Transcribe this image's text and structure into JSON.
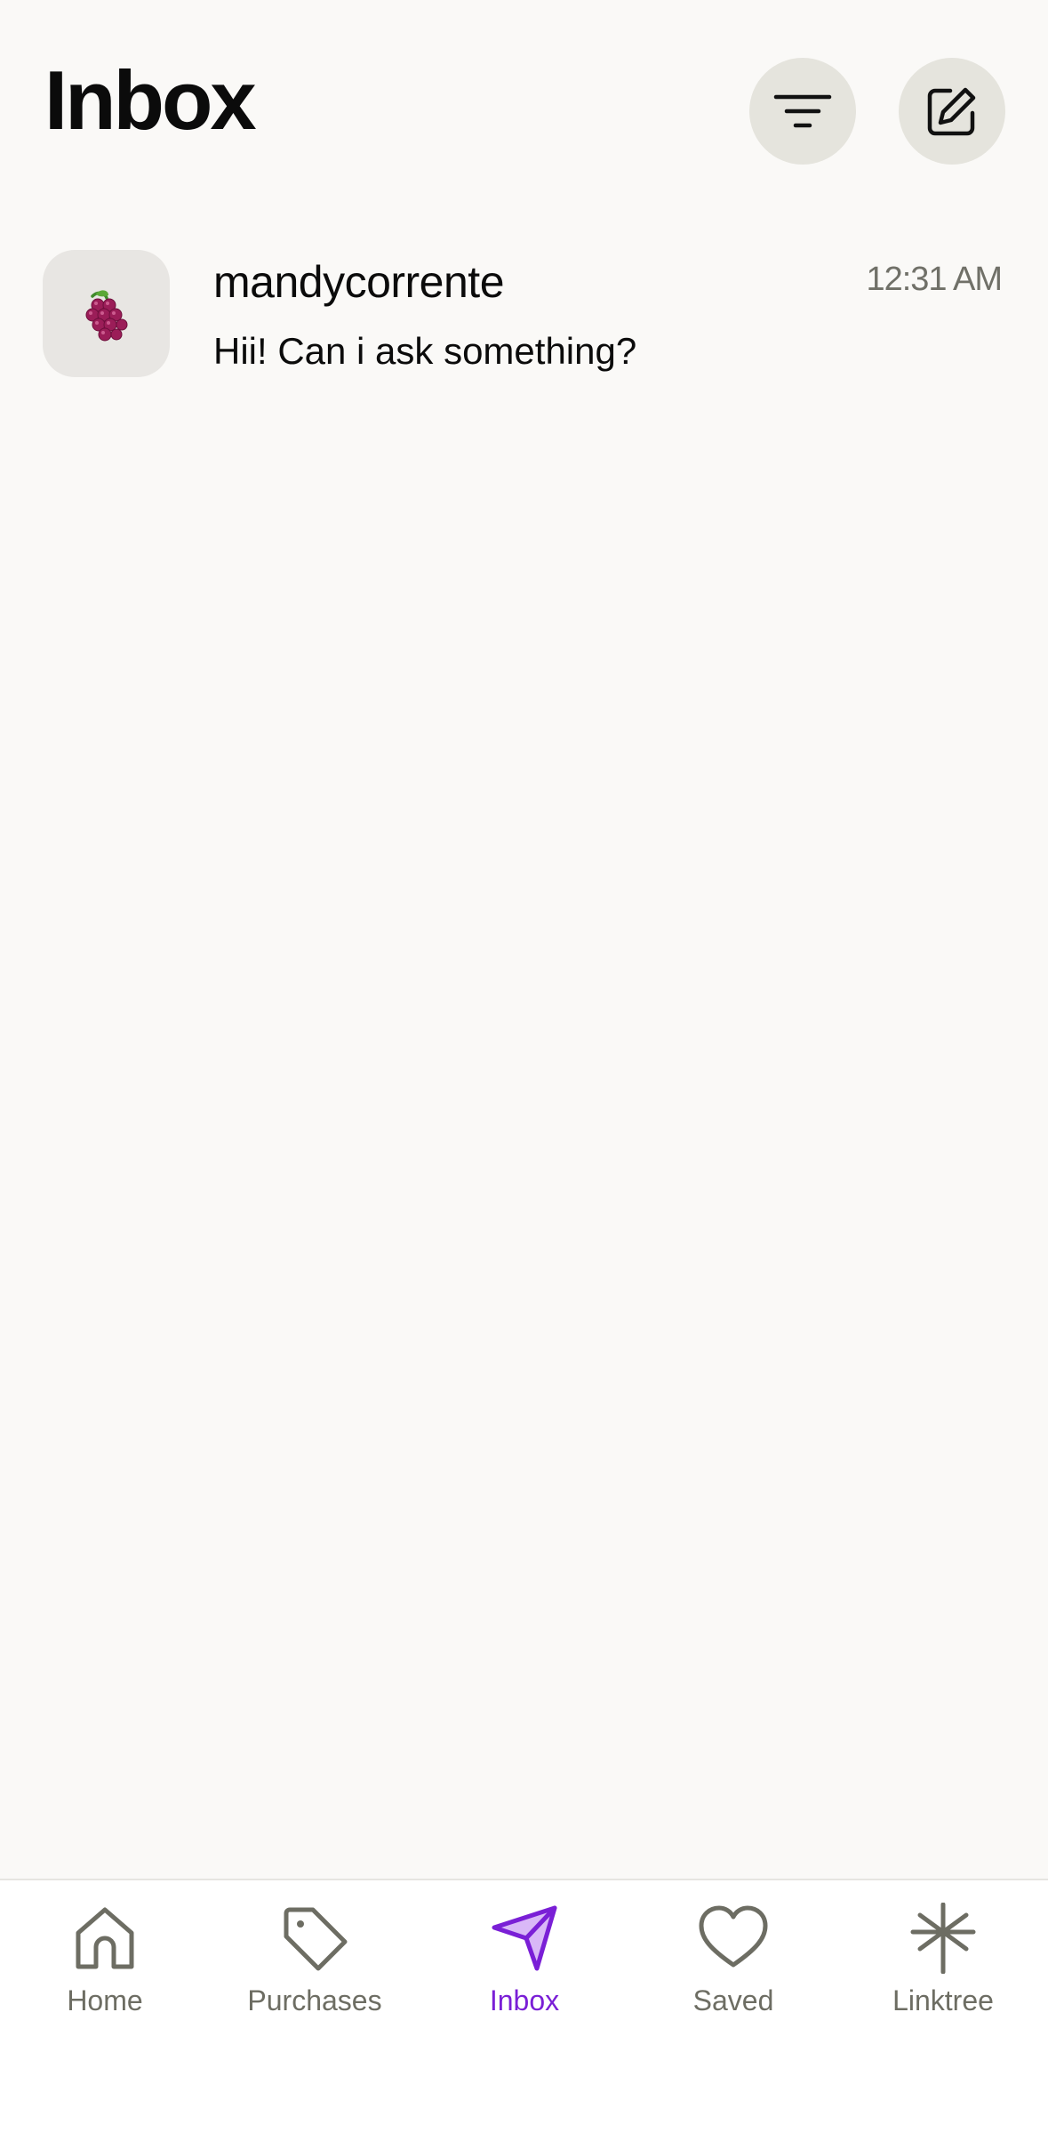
{
  "header": {
    "title": "Inbox"
  },
  "conversations": [
    {
      "name": "mandycorrente",
      "time": "12:31 AM",
      "preview": "Hii! Can i ask something?",
      "avatar": "grapes-icon"
    }
  ],
  "tabbar": {
    "items": [
      {
        "label": "Home",
        "icon": "home-icon"
      },
      {
        "label": "Purchases",
        "icon": "tag-icon"
      },
      {
        "label": "Inbox",
        "icon": "send-icon"
      },
      {
        "label": "Saved",
        "icon": "heart-icon"
      },
      {
        "label": "Linktree",
        "icon": "linktree-icon"
      }
    ],
    "active_index": 2
  },
  "colors": {
    "background": "#faf9f7",
    "button_bg": "#e5e4dd",
    "accent": "#7a1fd6",
    "muted": "#6d6d63"
  }
}
